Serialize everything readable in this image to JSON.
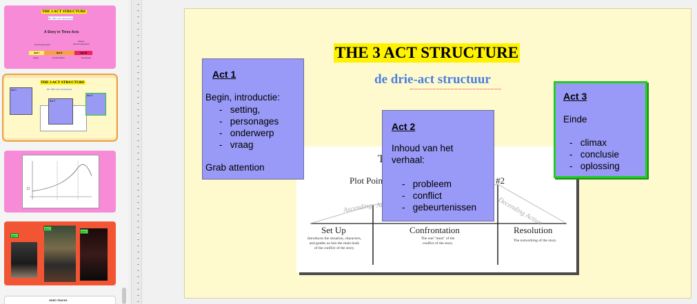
{
  "filmstrip": {
    "slide1": {
      "title": "THE 3 ACT STRUCTURE",
      "subtitle": "de drie-act structuur",
      "heading": "A Story in Three Acts",
      "tp1": "1st Turning Point",
      "tp2": "Climax\n2nd Turning Point",
      "acts": [
        "Act I",
        "Act II",
        "Act III"
      ],
      "act_notes": [
        "Setup",
        "Confrontation",
        "Resolution"
      ]
    },
    "slide2": {
      "title": "THE 3 ACT STRUCTURE",
      "subtitle": "de drie-act structuur",
      "act1": "Act 1",
      "act2": "Act 2",
      "act3": "Act 3"
    },
    "slide4": {
      "act1": "Act 1",
      "act2": "Act 2",
      "act3": "Act 3"
    },
    "slide5": {
      "title": "VIDEO TRACKS"
    }
  },
  "slide": {
    "title": "THE 3 ACT STRUCTURE",
    "subtitle": "de drie-act structuur",
    "act1": {
      "heading": "Act 1",
      "intro": "Begin, introductie:",
      "items": [
        "setting,",
        "personages",
        "onderwerp",
        "vraag"
      ],
      "footer": "Grab attention"
    },
    "act2": {
      "heading": "Act 2",
      "intro_line1": "Inhoud van het",
      "intro_line2": "verhaal:",
      "items": [
        "probleem",
        "conflict",
        "gebeurtenissen"
      ]
    },
    "act3": {
      "heading": "Act 3",
      "intro": "Einde",
      "items": [
        "climax",
        "conclusie",
        "oplossing"
      ]
    },
    "diagram": {
      "title_fragment": "T",
      "plot_point_1": "Plot Point",
      "plot_point_2": "#2",
      "ascending": "Ascending",
      "ascending_tail": "Ac",
      "descending": "Decending Action",
      "sections": [
        "Set Up",
        "Confrontation",
        "Resolution"
      ],
      "setup_note": "Introduces the situation, characters,\nand guides us into the main body\nof the conflict of the story.",
      "confrontation_note": "The real \"meat\" of the\nconflict of the story.",
      "resolution_note": "The outworking of the story."
    },
    "colors": {
      "background": "#fffacd",
      "title_highlight": "#fff200",
      "subtitle": "#4a80e0",
      "act_box": "#9999f7",
      "act3_border": "#22cc22"
    }
  }
}
